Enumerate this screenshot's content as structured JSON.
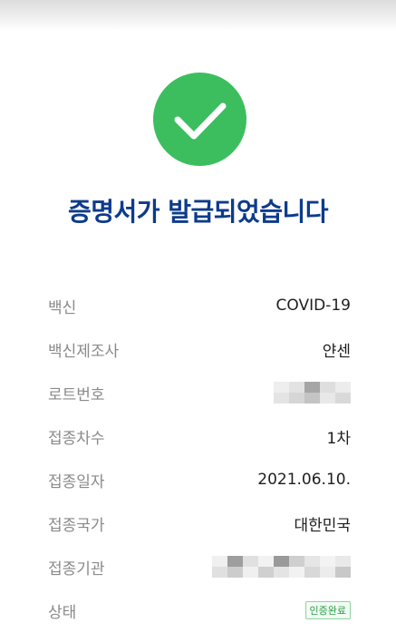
{
  "title": "증명서가 발급되었습니다",
  "rows": [
    {
      "label": "백신",
      "value": "COVID-19"
    },
    {
      "label": "백신제조사",
      "value": "얀센"
    },
    {
      "label": "로트번호"
    },
    {
      "label": "접종차수",
      "value": "1차"
    },
    {
      "label": "접종일자",
      "value": "2021.06.10."
    },
    {
      "label": "접종국가",
      "value": "대한민국"
    },
    {
      "label": "접종기관"
    },
    {
      "label": "상태",
      "badge": "인증완료"
    }
  ],
  "colors": {
    "check": "#3cbe5f",
    "title": "#0d3b8c",
    "label": "#8a8a8a",
    "badge": "#2a9a45"
  },
  "icons": {
    "success": "checkmark-circle-icon"
  }
}
